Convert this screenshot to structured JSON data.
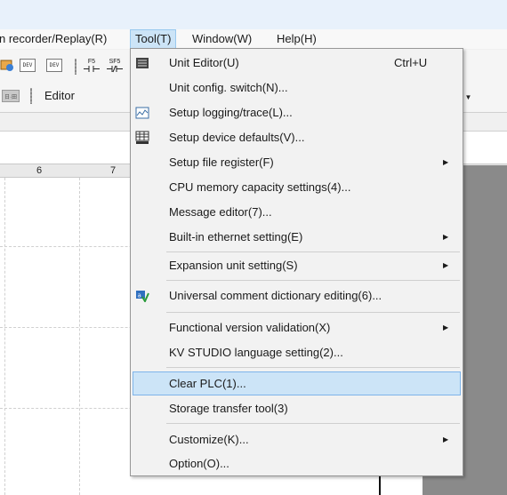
{
  "menubar": {
    "items": [
      {
        "label": "n recorder/Replay(R)"
      },
      {
        "label": "Tool(T)"
      },
      {
        "label": "Window(W)"
      },
      {
        "label": "Help(H)"
      }
    ]
  },
  "toolbar": {
    "dev_label": "DEV",
    "f5_label": "F5",
    "sf5_label": "SF5",
    "editor_label": "Editor",
    "chip_label": "日·田"
  },
  "grid": {
    "columns": [
      "6",
      "7"
    ]
  },
  "tool_menu": {
    "items": [
      {
        "label": "Unit Editor(U)",
        "shortcut": "Ctrl+U",
        "icon": "unit-editor-icon"
      },
      {
        "label": "Unit config. switch(N)..."
      },
      {
        "label": "Setup logging/trace(L)...",
        "icon": "logging-trace-icon"
      },
      {
        "label": "Setup device defaults(V)...",
        "icon": "device-init-icon"
      },
      {
        "label": "Setup file register(F)",
        "submenu": true
      },
      {
        "label": "CPU memory capacity settings(4)..."
      },
      {
        "label": "Message editor(7)..."
      },
      {
        "label": "Built-in ethernet setting(E)",
        "submenu": true
      },
      {
        "label": "Expansion unit setting(S)",
        "submenu": true
      },
      {
        "label": "Universal comment dictionary editing(6)...",
        "icon": "comment-dictionary-icon"
      },
      {
        "label": "Functional version validation(X)",
        "submenu": true
      },
      {
        "label": "KV STUDIO language setting(2)..."
      },
      {
        "label": "Clear PLC(1)...",
        "highlighted": true
      },
      {
        "label": "Storage transfer tool(3)"
      },
      {
        "label": "Customize(K)...",
        "submenu": true
      },
      {
        "label": "Option(O)..."
      }
    ]
  },
  "colors": {
    "highlight": "#cce4f7",
    "highlight_border": "#7eb4ea",
    "gray_area": "#8a8a8a"
  }
}
